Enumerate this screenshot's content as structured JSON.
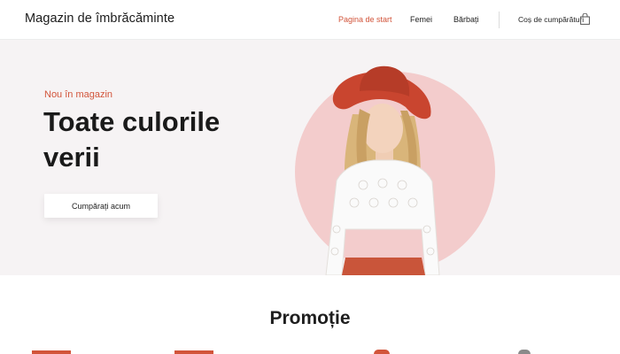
{
  "header": {
    "logo": "Magazin de îmbrăcăminte",
    "nav": [
      {
        "label": "Pagina de start",
        "active": true
      },
      {
        "label": "Femei",
        "active": false
      },
      {
        "label": "Bărbați",
        "active": false
      }
    ],
    "cart_label": "Coș de cumpărături",
    "cart_icon": "shopping-bag-icon"
  },
  "hero": {
    "eyebrow": "Nou în magazin",
    "headline": "Toate culorile verii",
    "cta_label": "Cumpărați acum",
    "image_icon": "fashion-model-photo"
  },
  "promo": {
    "title": "Promoție"
  },
  "colors": {
    "accent": "#d2543a",
    "hero_bg": "#f6f3f4",
    "circle": "#f3cccc"
  }
}
